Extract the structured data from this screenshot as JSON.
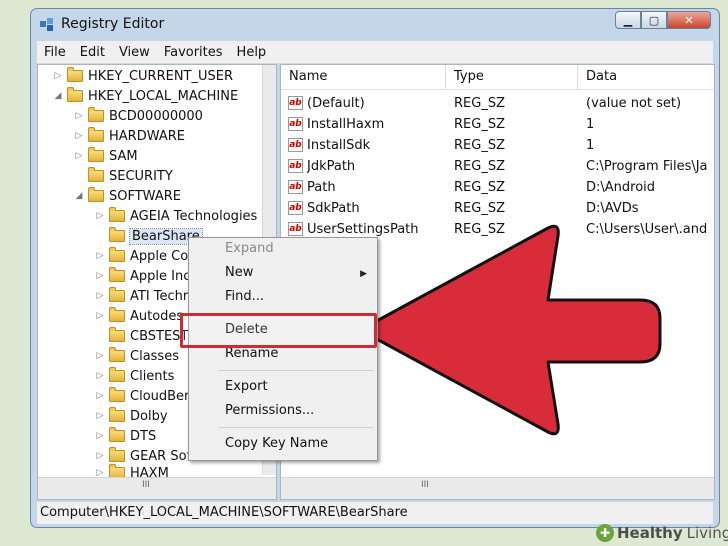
{
  "window": {
    "title": "Registry Editor"
  },
  "menubar": [
    "File",
    "Edit",
    "View",
    "Favorites",
    "Help"
  ],
  "tree": [
    {
      "label": "HKEY_CURRENT_USER",
      "expander": "▷"
    },
    {
      "label": "HKEY_LOCAL_MACHINE",
      "expander": "◢"
    },
    {
      "label": "BCD00000000",
      "expander": "▷"
    },
    {
      "label": "HARDWARE",
      "expander": "▷"
    },
    {
      "label": "SAM",
      "expander": "▷"
    },
    {
      "label": "SECURITY",
      "expander": ""
    },
    {
      "label": "SOFTWARE",
      "expander": "◢"
    },
    {
      "label": "AGEIA Technologies",
      "expander": "▷"
    },
    {
      "label": "BearShare",
      "expander": "",
      "selected": true
    },
    {
      "label": "Apple Cor",
      "expander": "▷"
    },
    {
      "label": "Apple Inc",
      "expander": "▷"
    },
    {
      "label": "ATI Techr",
      "expander": "▷"
    },
    {
      "label": "Autodes",
      "expander": "▷"
    },
    {
      "label": "CBSTEST",
      "expander": ""
    },
    {
      "label": "Classes",
      "expander": "▷"
    },
    {
      "label": "Clients",
      "expander": "▷"
    },
    {
      "label": "CloudBer",
      "expander": "▷"
    },
    {
      "label": "Dolby",
      "expander": "▷"
    },
    {
      "label": "DTS",
      "expander": "▷"
    },
    {
      "label": "GEAR Sof",
      "expander": "▷"
    },
    {
      "label": "HAXM",
      "expander": "▷"
    }
  ],
  "values_table": {
    "headers": [
      "Name",
      "Type",
      "Data"
    ],
    "rows": [
      {
        "name": "(Default)",
        "type": "REG_SZ",
        "data": "(value not set)"
      },
      {
        "name": "InstallHaxm",
        "type": "REG_SZ",
        "data": "1"
      },
      {
        "name": "InstallSdk",
        "type": "REG_SZ",
        "data": "1"
      },
      {
        "name": "JdkPath",
        "type": "REG_SZ",
        "data": "C:\\Program Files\\Ja"
      },
      {
        "name": "Path",
        "type": "REG_SZ",
        "data": "D:\\Android"
      },
      {
        "name": "SdkPath",
        "type": "REG_SZ",
        "data": "D:\\AVDs"
      },
      {
        "name": "UserSettingsPath",
        "type": "REG_SZ",
        "data": "C:\\Users\\User\\.and"
      }
    ]
  },
  "context_menu": {
    "expand": "Expand",
    "new": "New",
    "find": "Find...",
    "delete": "Delete",
    "rename": "Rename",
    "export": "Export",
    "permissions": "Permissions...",
    "copy_key_name": "Copy Key Name"
  },
  "statusbar": "Computer\\HKEY_LOCAL_MACHINE\\SOFTWARE\\BearShare",
  "scroll_glyph": "III",
  "watermark": {
    "brand_a": "Healthy",
    "brand_b": "Living"
  },
  "colors": {
    "arrow": "#d92c3a",
    "highlight_box": "#d02a35",
    "selection": "#dbe6f4"
  }
}
